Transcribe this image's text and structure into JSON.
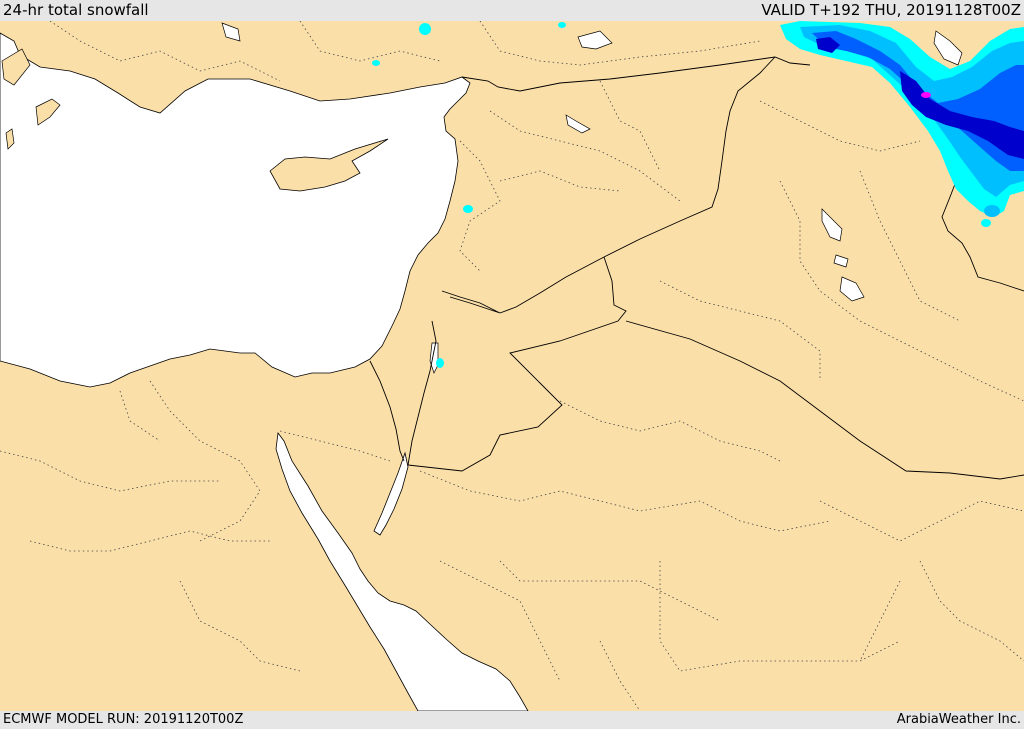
{
  "header": {
    "title": "24-hr total snowfall",
    "valid": "VALID T+192 THU, 20191128T00Z"
  },
  "footer": {
    "model_run": "ECMWF MODEL RUN: 20191120T00Z",
    "credit": "ArabiaWeather Inc."
  },
  "map": {
    "land_color": "#fbdfa9",
    "water_color": "#ffffff",
    "snow_colors": [
      "#00ffff",
      "#00bfff",
      "#0060ff",
      "#0000cc",
      "#ff00ff"
    ]
  }
}
